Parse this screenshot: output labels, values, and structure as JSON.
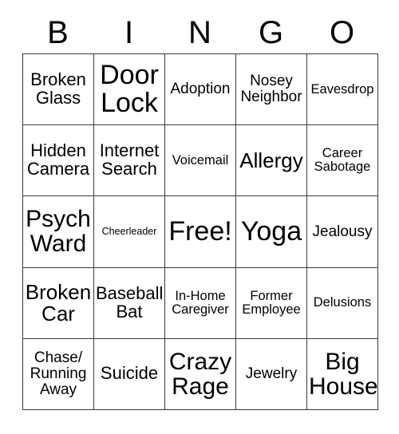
{
  "header": {
    "letters": [
      "B",
      "I",
      "N",
      "G",
      "O"
    ]
  },
  "colors": {
    "background": "#ffffff",
    "border": "#3a3a3a",
    "text": "#000000"
  },
  "grid": {
    "columns": 5,
    "rows": 5,
    "free_space_label": "Free!",
    "free_space_position": {
      "row": 3,
      "column": 3
    },
    "cells": [
      [
        {
          "label": "Broken Glass",
          "size": "fs-xl"
        },
        {
          "label": "Door Lock",
          "size": "fs-4xl"
        },
        {
          "label": "Adoption",
          "size": "fs-lg"
        },
        {
          "label": "Nosey Neighbor",
          "size": "fs-lg"
        },
        {
          "label": "Eavesdrop",
          "size": "fs-md"
        }
      ],
      [
        {
          "label": "Hidden Camera",
          "size": "fs-xl"
        },
        {
          "label": "Internet Search",
          "size": "fs-xl"
        },
        {
          "label": "Voicemail",
          "size": "fs-md"
        },
        {
          "label": "Allergy",
          "size": "fs-2xl"
        },
        {
          "label": "Career Sabotage",
          "size": "fs-md"
        }
      ],
      [
        {
          "label": "Psych Ward",
          "size": "fs-3xl"
        },
        {
          "label": "Cheerleader",
          "size": "fs-xs"
        },
        {
          "label": "Free!",
          "size": "fs-4xl"
        },
        {
          "label": "Yoga",
          "size": "fs-4xl"
        },
        {
          "label": "Jealousy",
          "size": "fs-lg"
        }
      ],
      [
        {
          "label": "Broken Car",
          "size": "fs-2xl"
        },
        {
          "label": "Baseball Bat",
          "size": "fs-xl"
        },
        {
          "label": "In-Home Caregiver",
          "size": "fs-md"
        },
        {
          "label": "Former Employee",
          "size": "fs-md"
        },
        {
          "label": "Delusions",
          "size": "fs-md"
        }
      ],
      [
        {
          "label": "Chase/ Running Away",
          "size": "fs-lg"
        },
        {
          "label": "Suicide",
          "size": "fs-xl"
        },
        {
          "label": "Crazy Rage",
          "size": "fs-3xl"
        },
        {
          "label": "Jewelry",
          "size": "fs-lg"
        },
        {
          "label": "Big House",
          "size": "fs-3xl"
        }
      ]
    ]
  }
}
